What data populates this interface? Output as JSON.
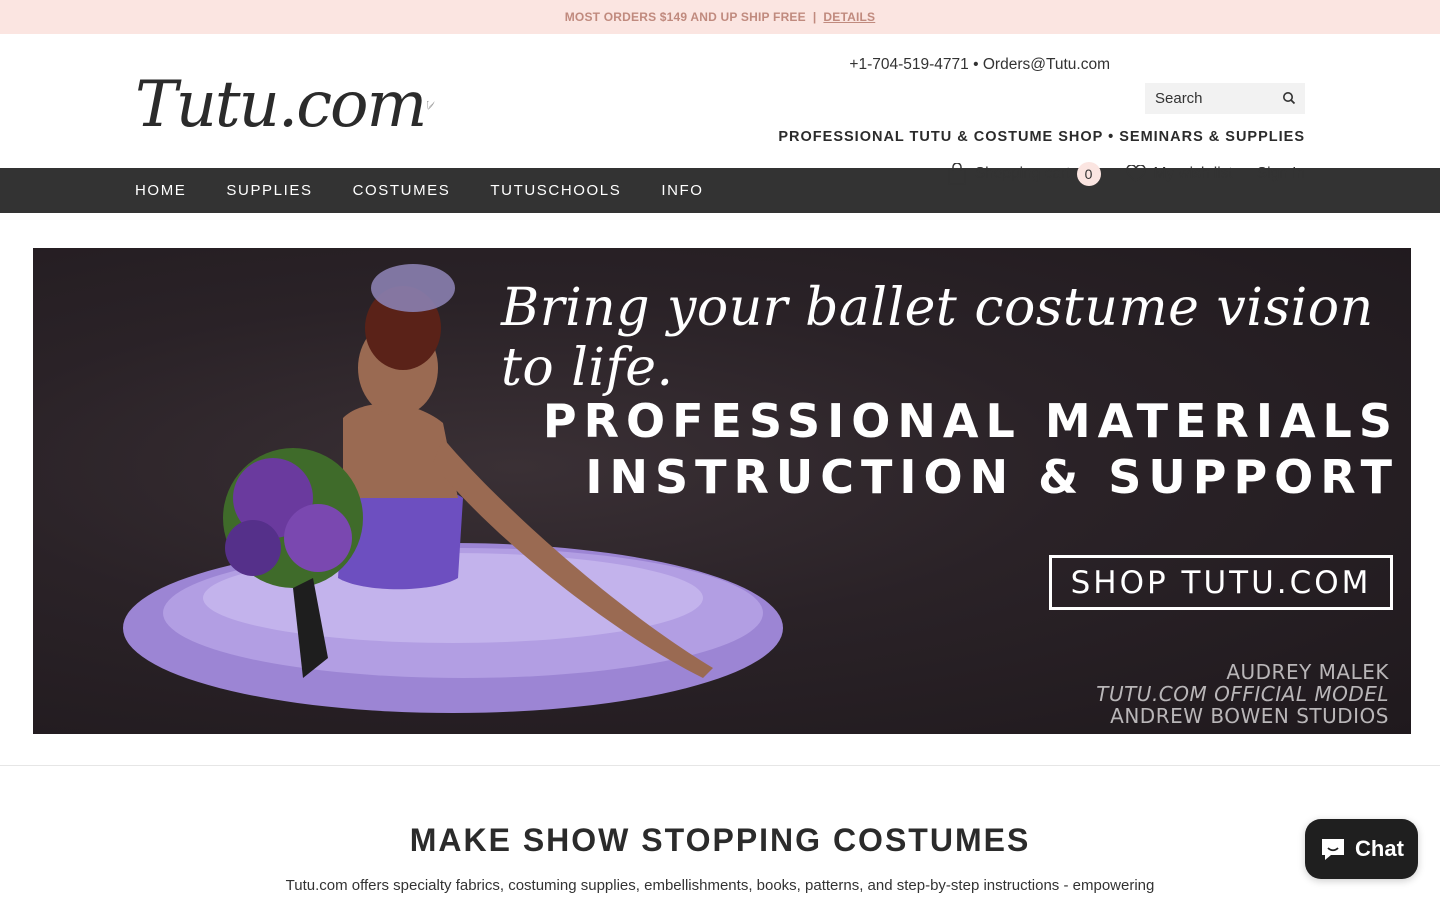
{
  "announcement": {
    "text": "MOST ORDERS $149 AND UP SHIP FREE",
    "separator": "|",
    "link": "DETAILS"
  },
  "header": {
    "logo_text": "Tutu.com",
    "phone": "+1-704-519-4771",
    "contact_sep": "•",
    "email": "Orders@Tutu.com",
    "search_placeholder": "Search",
    "tagline": "PROFESSIONAL TUTU & COSTUME SHOP • SEMINARS & SUPPLIES",
    "cart_label": "Shopping cart",
    "cart_count": "0",
    "wishlist_label": "My wish list",
    "signin_label": "Sign In"
  },
  "nav": {
    "items": [
      "HOME",
      "SUPPLIES",
      "COSTUMES",
      "TUTUSCHOOLS",
      "INFO"
    ]
  },
  "hero": {
    "script_line": "Bring your ballet costume vision to life.",
    "headline_1": "PROFESSIONAL MATERIALS",
    "headline_2": "INSTRUCTION & SUPPORT",
    "button": "SHOP TUTU.COM",
    "credit_1": "AUDREY MALEK",
    "credit_2": "TUTU.COM OFFICIAL MODEL",
    "credit_3": "ANDREW BOWEN STUDIOS"
  },
  "section": {
    "title": "MAKE SHOW STOPPING COSTUMES",
    "text": "Tutu.com offers specialty fabrics, costuming supplies, embellishments, books, patterns, and step-by-step instructions -  empowering"
  },
  "chat": {
    "label": "Chat"
  },
  "colors": {
    "announcement_bg": "#fbe5e1",
    "announcement_text": "#c08a7e",
    "nav_bg": "#333333",
    "tutu_purple": "#a58bd9",
    "chat_bg": "#1f1f1f"
  }
}
